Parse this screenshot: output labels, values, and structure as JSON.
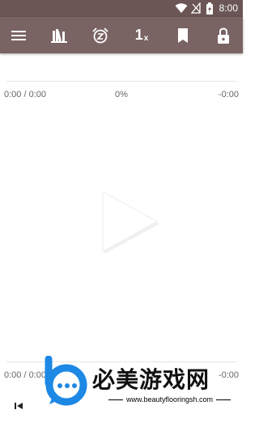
{
  "status_bar": {
    "time": "8:00",
    "icons": [
      "wifi-icon",
      "signal-icon",
      "battery-icon"
    ]
  },
  "toolbar": {
    "buttons": [
      {
        "icon": "menu-icon"
      },
      {
        "icon": "library-icon"
      },
      {
        "icon": "sleep-timer-icon"
      },
      {
        "icon": "playback-speed",
        "label": "1",
        "suffix": "x"
      },
      {
        "icon": "bookmark-icon"
      },
      {
        "icon": "lock-icon"
      }
    ]
  },
  "progress_top": {
    "position": "0:00 / 0:00",
    "percent": "0%",
    "remaining": "-0:00"
  },
  "progress_bottom": {
    "position": "0:00 / 0:00",
    "remaining": "-0:00"
  },
  "controls": {
    "play_icon": "play-icon",
    "previous_icon": "previous-icon"
  },
  "watermark": {
    "title": "必美游戏网",
    "url": "www.beautyflooringsh.com"
  },
  "colors": {
    "toolbar": "#7a6363",
    "status_bar": "#6b5555",
    "watermark_blue": "#1e88e5"
  }
}
